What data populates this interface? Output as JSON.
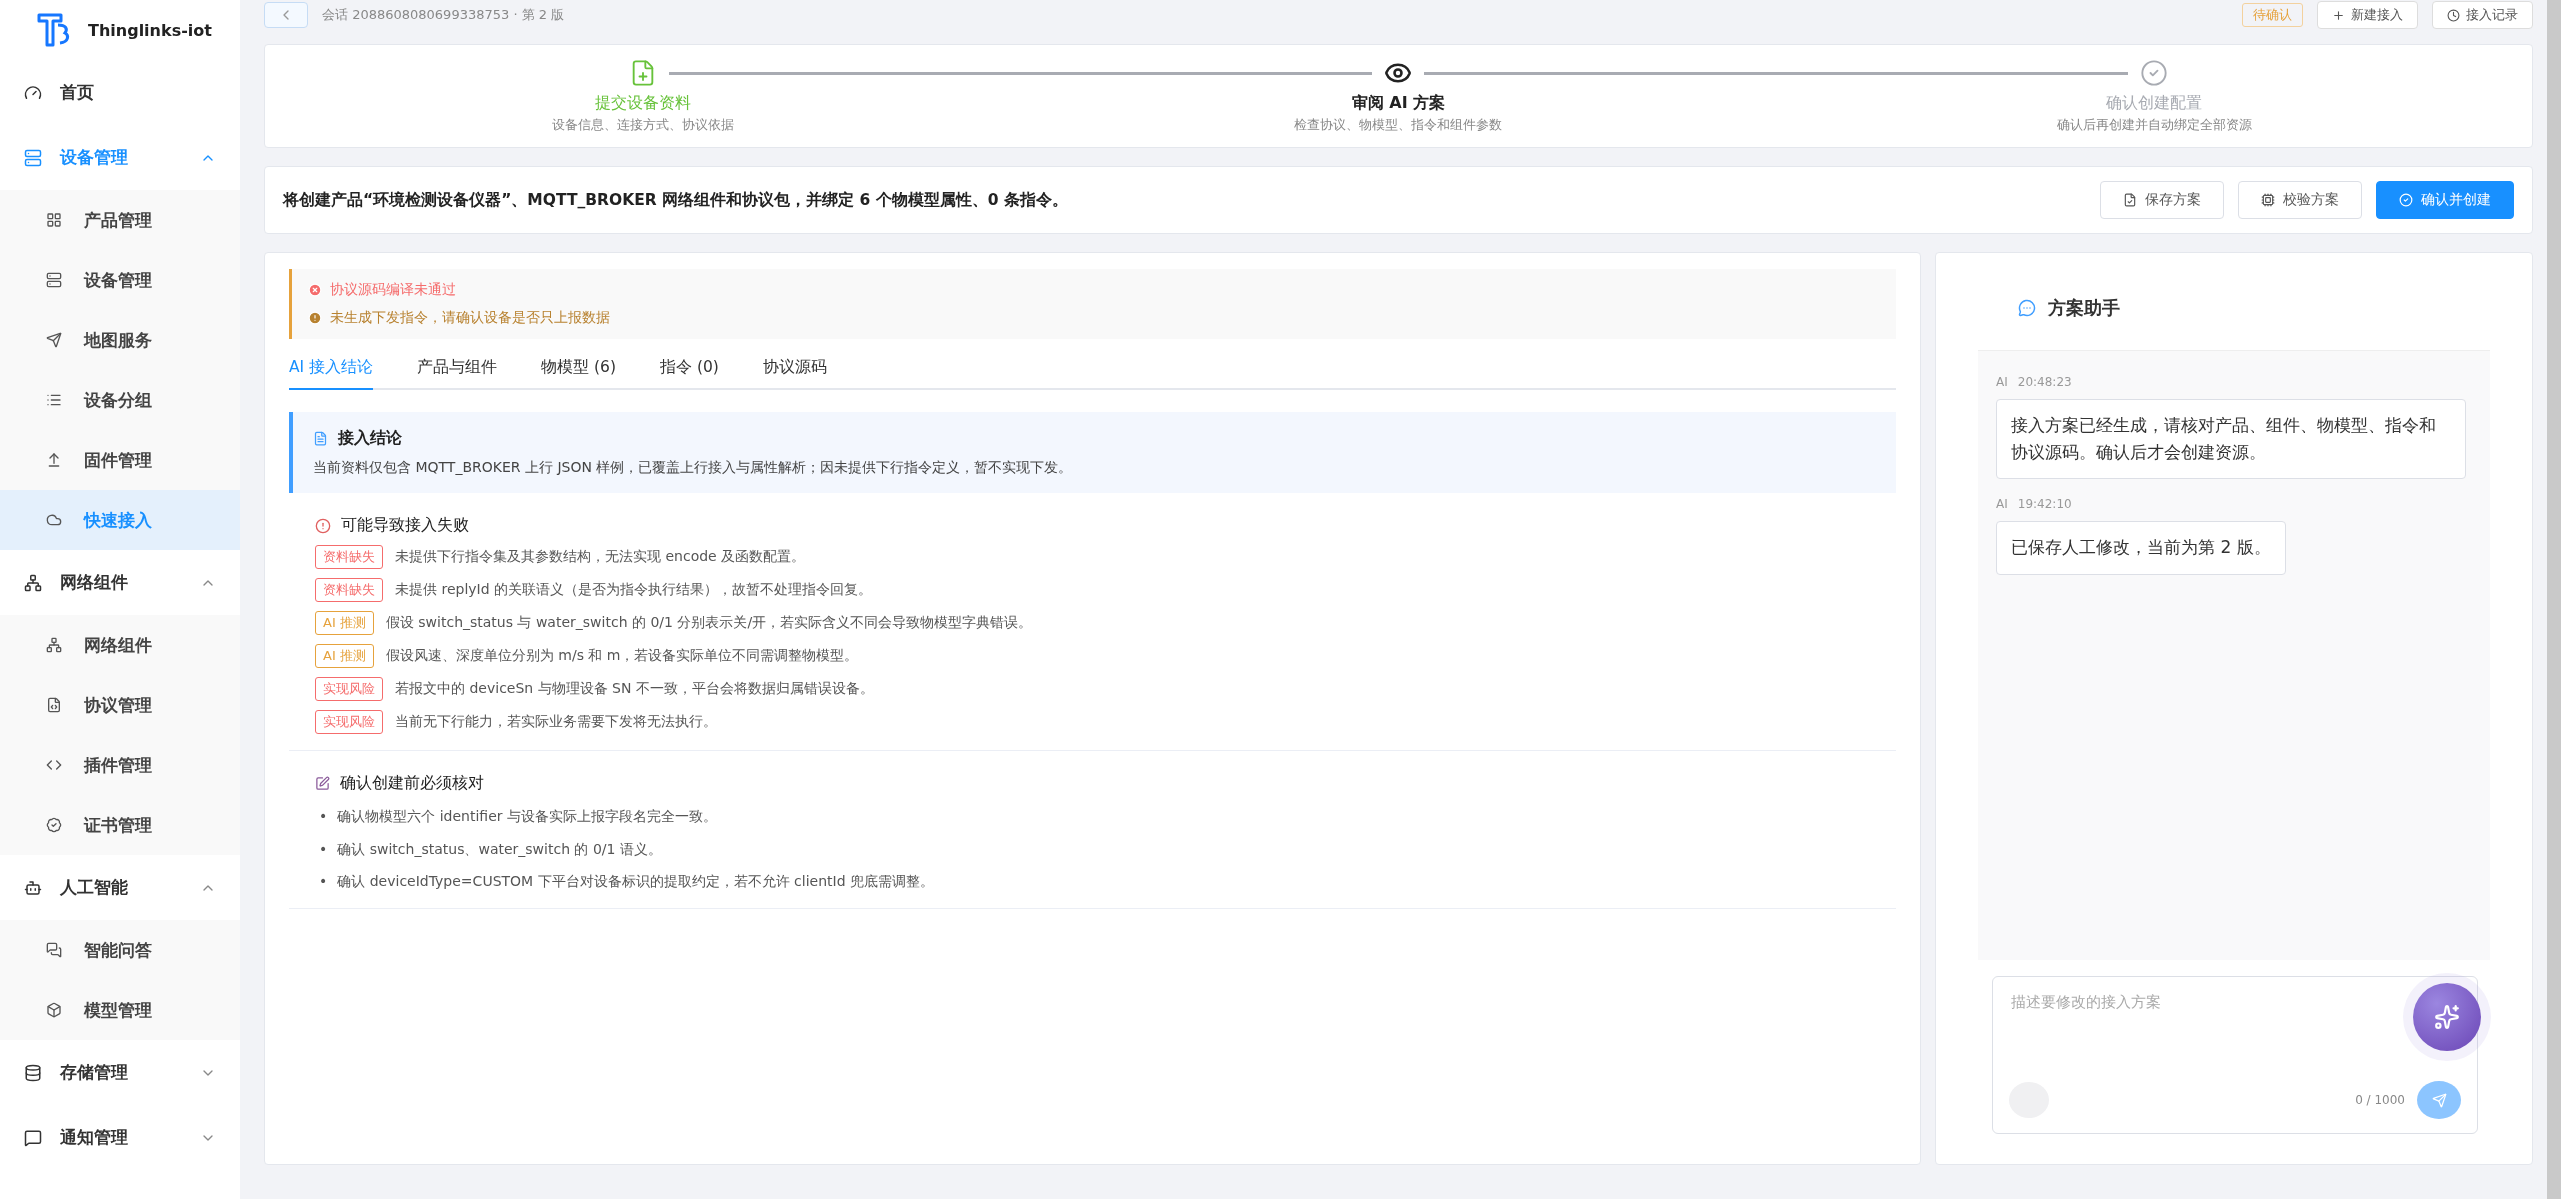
{
  "brand": {
    "name": "Thinglinks-iot"
  },
  "sidebar": {
    "items": [
      {
        "kind": "link",
        "label": "首页",
        "selected": false
      },
      {
        "kind": "group",
        "label": "设备管理",
        "expanded": true,
        "children": [
          {
            "label": "产品管理",
            "selected": false
          },
          {
            "label": "设备管理",
            "selected": false
          },
          {
            "label": "地图服务",
            "selected": false
          },
          {
            "label": "设备分组",
            "selected": false
          },
          {
            "label": "固件管理",
            "selected": false
          },
          {
            "label": "快速接入",
            "selected": true
          }
        ]
      },
      {
        "kind": "group",
        "label": "网络组件",
        "expanded": true,
        "children": [
          {
            "label": "网络组件",
            "selected": false
          },
          {
            "label": "协议管理",
            "selected": false
          },
          {
            "label": "插件管理",
            "selected": false
          },
          {
            "label": "证书管理",
            "selected": false
          }
        ]
      },
      {
        "kind": "group",
        "label": "人工智能",
        "expanded": true,
        "children": [
          {
            "label": "智能问答",
            "selected": false
          },
          {
            "label": "模型管理",
            "selected": false
          }
        ]
      },
      {
        "kind": "group",
        "label": "存储管理",
        "expanded": false
      },
      {
        "kind": "group",
        "label": "通知管理",
        "expanded": false
      }
    ]
  },
  "header": {
    "session": "会话 2088608080699338753 · 第 2 版",
    "status_tag": "待确认",
    "buttons": [
      "新建接入",
      "接入记录"
    ]
  },
  "steps": [
    {
      "title": "提交设备资料",
      "subtitle": "设备信息、连接方式、协议依据",
      "done": true,
      "selected": false
    },
    {
      "title": "审阅 AI 方案",
      "subtitle": "检查协议、物模型、指令和组件参数",
      "done": false,
      "selected": true
    },
    {
      "title": "确认创建配置",
      "subtitle": "确认后再创建并自动绑定全部资源",
      "done": false,
      "selected": false
    }
  ],
  "summary": {
    "text": "将创建产品“环境检测设备仪器”、MQTT_BROKER 网络组件和协议包，并绑定 6 个物模型属性、0 条指令。",
    "buttons": [
      {
        "label": "保存方案",
        "kind": "default"
      },
      {
        "label": "校验方案",
        "kind": "default"
      },
      {
        "label": "确认并创建",
        "kind": "primary"
      }
    ]
  },
  "alerts": [
    {
      "kind": "error",
      "text": "协议源码编译未通过"
    },
    {
      "kind": "warning",
      "text": "未生成下发指令，请确认设备是否只上报数据"
    }
  ],
  "tabs": [
    {
      "label": "AI 接入结论",
      "selected": true
    },
    {
      "label": "产品与组件",
      "selected": false
    },
    {
      "label": "物模型 (6)",
      "selected": false
    },
    {
      "label": "指令 (0)",
      "selected": false
    },
    {
      "label": "协议源码",
      "selected": false
    }
  ],
  "conclusion": {
    "title": "接入结论",
    "text": "当前资料仅包含 MQTT_BROKER 上行 JSON 样例，已覆盖上行接入与属性解析；因未提供下行指令定义，暂不实现下发。"
  },
  "risks": {
    "title": "可能导致接入失败",
    "items": [
      {
        "tag": "资料缺失",
        "color": "#f56c6c",
        "text": "未提供下行指令集及其参数结构，无法实现 encode 及函数配置。"
      },
      {
        "tag": "资料缺失",
        "color": "#f56c6c",
        "text": "未提供 replyId 的关联语义（是否为指令执行结果），故暂不处理指令回复。"
      },
      {
        "tag": "AI 推测",
        "color": "#e6a23c",
        "text": "假设 switch_status 与 water_switch 的 0/1 分别表示关/开，若实际含义不同会导致物模型字典错误。"
      },
      {
        "tag": "AI 推测",
        "color": "#e6a23c",
        "text": "假设风速、深度单位分别为 m/s 和 m，若设备实际单位不同需调整物模型。"
      },
      {
        "tag": "实现风险",
        "color": "#f56c6c",
        "text": "若报文中的 deviceSn 与物理设备 SN 不一致，平台会将数据归属错误设备。"
      },
      {
        "tag": "实现风险",
        "color": "#f56c6c",
        "text": "当前无下行能力，若实际业务需要下发将无法执行。"
      }
    ]
  },
  "checklist": {
    "title": "确认创建前必须核对",
    "bullet": "•",
    "items": [
      "确认物模型六个 identifier 与设备实际上报字段名完全一致。",
      "确认 switch_status、water_switch 的 0/1 语义。",
      "确认 deviceIdType=CUSTOM 下平台对设备标识的提取约定，若不允许 clientId 兜底需调整。"
    ]
  },
  "assistant": {
    "title": "方案助手",
    "messages": [
      {
        "sender": "AI",
        "time": "20:48:23",
        "text": "接入方案已经生成，请核对产品、组件、物模型、指令和协议源码。确认后才会创建资源。"
      },
      {
        "sender": "AI",
        "time": "19:42:10",
        "text": "已保存人工修改，当前为第 2 版。"
      }
    ],
    "input": {
      "placeholder": "描述要修改的接入方案",
      "counter": "0 / 1000"
    }
  }
}
